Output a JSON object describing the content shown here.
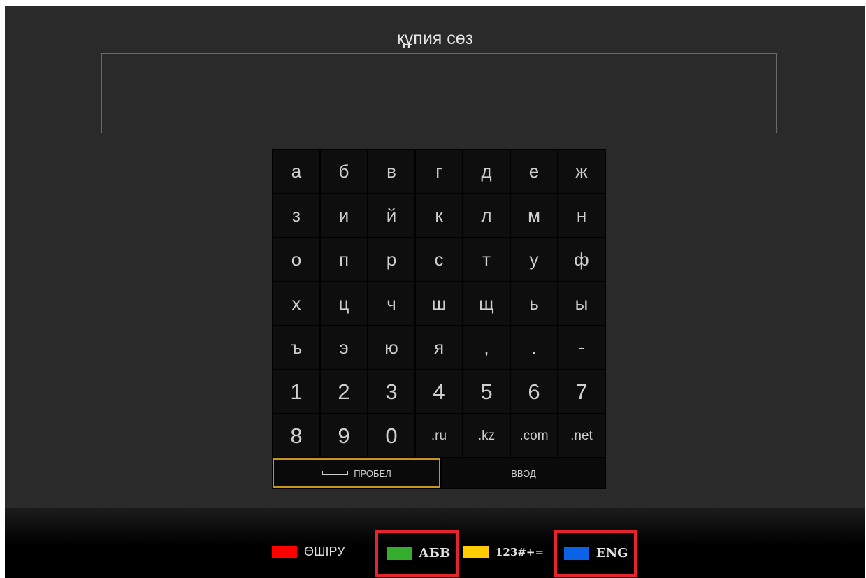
{
  "header": {
    "title": "құпия сөз"
  },
  "password_field": {
    "value": ""
  },
  "keyboard": {
    "rows": [
      [
        "а",
        "б",
        "в",
        "г",
        "д",
        "е",
        "ж"
      ],
      [
        "з",
        "и",
        "й",
        "к",
        "л",
        "м",
        "н"
      ],
      [
        "о",
        "п",
        "р",
        "с",
        "т",
        "у",
        "ф"
      ],
      [
        "х",
        "ц",
        "ч",
        "ш",
        "щ",
        "ь",
        "ы"
      ],
      [
        "ъ",
        "э",
        "ю",
        "я",
        ",",
        ".",
        "-"
      ],
      [
        "1",
        "2",
        "3",
        "4",
        "5",
        "6",
        "7"
      ],
      [
        "8",
        "9",
        "0",
        ".ru",
        ".kz",
        ".com",
        ".net"
      ]
    ],
    "space_label": "ПРОБЕЛ",
    "enter_label": "ВВОД"
  },
  "legend": {
    "delete": {
      "label": "ӨШІРУ",
      "color": "#ff0000"
    },
    "abv": {
      "label": "АБВ",
      "color": "#34ad2e"
    },
    "symbols": {
      "label": "123#+=",
      "color": "#ffcc00"
    },
    "eng": {
      "label": "ENG",
      "color": "#0a63e6"
    },
    "highlight_color": "#e5252b"
  }
}
